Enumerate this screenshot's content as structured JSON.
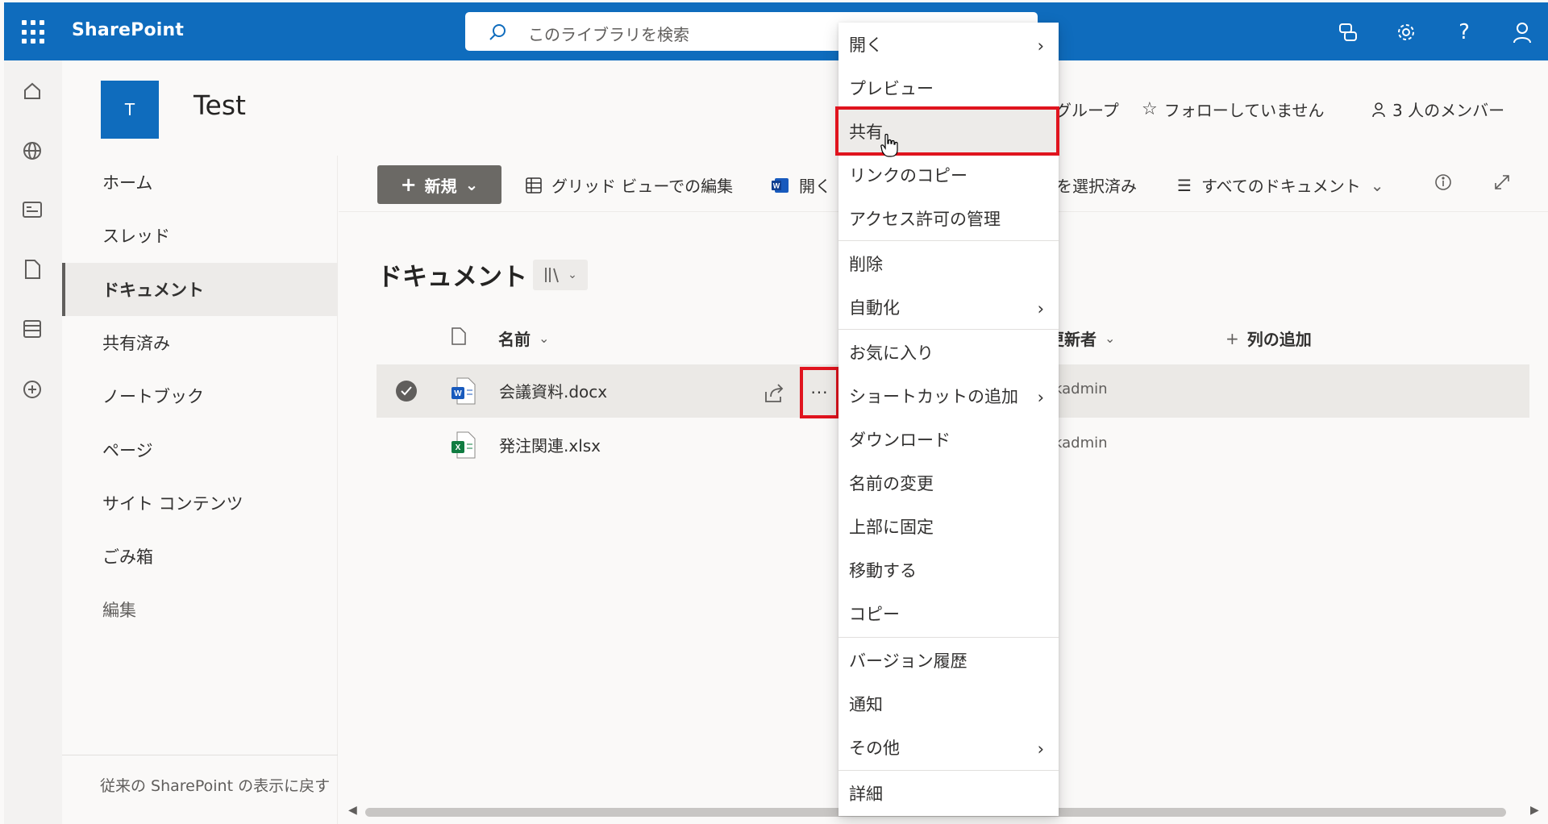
{
  "suitebar": {
    "brand": "SharePoint",
    "search_placeholder": "このライブラリを検索",
    "icons": [
      "waffle-icon",
      "teams-chat-icon",
      "gear-icon",
      "help-icon",
      "person-icon"
    ]
  },
  "site": {
    "logo_letter": "T",
    "title": "Test",
    "group_label": "グループ",
    "follow_label": "フォローしていません",
    "members_label": "3 人のメンバー"
  },
  "leftnav": {
    "items": [
      {
        "label": "ホーム"
      },
      {
        "label": "スレッド"
      },
      {
        "label": "ドキュメント",
        "selected": true
      },
      {
        "label": "共有済み"
      },
      {
        "label": "ノートブック"
      },
      {
        "label": "ページ"
      },
      {
        "label": "サイト コンテンツ"
      },
      {
        "label": "ごみ箱"
      },
      {
        "label": "編集"
      }
    ],
    "footer": "従来の SharePoint の表示に戻す"
  },
  "commandbar": {
    "new_label": "新規",
    "grid_edit_label": "グリッド ビューでの編集",
    "open_label": "開く",
    "selected_label": "を選択済み",
    "view_label": "すべてのドキュメント"
  },
  "library": {
    "title": "ドキュメント",
    "columns": {
      "name": "名前",
      "modified_by": "更新者",
      "add_column": "列の追加"
    },
    "rows": [
      {
        "name": "会議資料.docx",
        "modified_by": "kadmin",
        "type": "word",
        "selected": true
      },
      {
        "name": "発注関連.xlsx",
        "modified_by": "kadmin",
        "type": "excel",
        "selected": false
      }
    ]
  },
  "context_menu": {
    "items": [
      {
        "label": "開く",
        "submenu": true
      },
      {
        "label": "プレビュー"
      },
      {
        "label": "共有",
        "hover": true
      },
      {
        "label": "リンクのコピー"
      },
      {
        "label": "アクセス許可の管理"
      },
      {
        "label": "削除"
      },
      {
        "label": "自動化",
        "submenu": true
      },
      {
        "label": "お気に入り"
      },
      {
        "label": "ショートカットの追加",
        "submenu": true
      },
      {
        "label": "ダウンロード"
      },
      {
        "label": "名前の変更"
      },
      {
        "label": "上部に固定"
      },
      {
        "label": "移動する"
      },
      {
        "label": "コピー"
      },
      {
        "label": "バージョン履歴"
      },
      {
        "label": "通知"
      },
      {
        "label": "その他",
        "submenu": true
      },
      {
        "label": "詳細"
      }
    ]
  },
  "colors": {
    "brand": "#0f6cbd",
    "highlight": "#e0141e",
    "new_button": "#6b6965"
  }
}
